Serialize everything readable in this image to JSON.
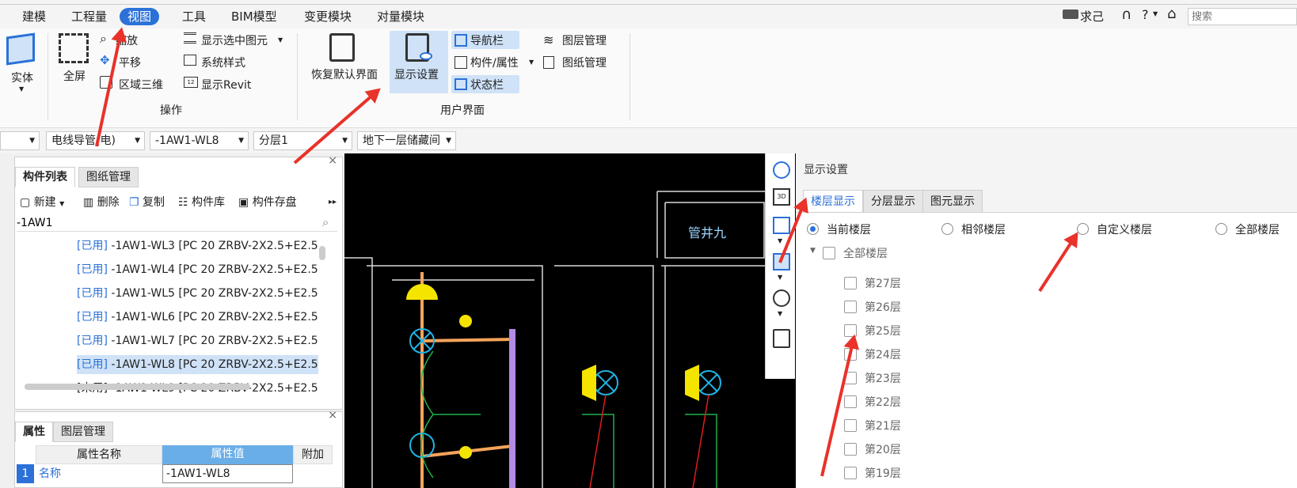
{
  "menu": {
    "items": [
      "建模",
      "工程量",
      "视图",
      "工具",
      "BIM模型",
      "变更模块",
      "对量模块"
    ],
    "active_index": 2,
    "right": {
      "user_label": "求己",
      "question_label": "?",
      "search_placeholder": "搜索"
    }
  },
  "ribbon": {
    "solid_label": "实体",
    "fullscreen_label": "全屏",
    "zoom_label": "缩放",
    "pan_label": "平移",
    "region3d_label": "区域三维",
    "show_selected_label": "显示选中图元",
    "system_style_label": "系统样式",
    "show_revit_label": "显示Revit",
    "operation_group": "操作",
    "restore_default_label": "恢复默认界面",
    "display_settings_label": "显示设置",
    "navbar_label": "导航栏",
    "component_props_label": "构件/属性",
    "statusbar_label": "状态栏",
    "layer_mgmt_label": "图层管理",
    "drawing_mgmt_label": "图纸管理",
    "ui_group": "用户界面"
  },
  "toolbar": {
    "combo1": "",
    "combo2": "电线导管(电)",
    "combo3": "-1AW1-WL8",
    "combo4": "分层1",
    "combo5": "地下一层储藏间"
  },
  "component_panel": {
    "tabs": [
      "构件列表",
      "图纸管理"
    ],
    "new_label": "新建",
    "delete_label": "删除",
    "copy_label": "复制",
    "library_label": "构件库",
    "save_label": "构件存盘",
    "search_value": "-1AW1",
    "rows": [
      {
        "status": "[已用]",
        "text": "-1AW1-WL3 [PC 20 ZRBV-2X2.5+E2.5"
      },
      {
        "status": "[已用]",
        "text": "-1AW1-WL4 [PC 20 ZRBV-2X2.5+E2.5"
      },
      {
        "status": "[已用]",
        "text": "-1AW1-WL5 [PC 20 ZRBV-2X2.5+E2.5"
      },
      {
        "status": "[已用]",
        "text": "-1AW1-WL6 [PC 20 ZRBV-2X2.5+E2.5"
      },
      {
        "status": "[已用]",
        "text": "-1AW1-WL7 [PC 20 ZRBV-2X2.5+E2.5"
      },
      {
        "status": "[已用]",
        "text": "-1AW1-WL8 [PC 20 ZRBV-2X2.5+E2.5"
      },
      {
        "status": "[未用]",
        "text": "-1AW1-WL9 [PC 20 ZRBV-2X2.5+E2.5"
      }
    ],
    "selected_index": 5
  },
  "property_panel": {
    "tabs": [
      "属性",
      "图层管理"
    ],
    "headers": [
      "属性名称",
      "属性值",
      "附加"
    ],
    "rows": [
      {
        "no": "1",
        "name": "名称",
        "value": "-1AW1-WL8"
      }
    ]
  },
  "canvas": {
    "label": "管井九"
  },
  "settings": {
    "title": "显示设置",
    "tabs": [
      "楼层显示",
      "分层显示",
      "图元显示"
    ],
    "radios": [
      "当前楼层",
      "相邻楼层",
      "自定义楼层",
      "全部楼层"
    ],
    "radio_selected": 0,
    "all_floors_label": "全部楼层",
    "floors": [
      "第27层",
      "第26层",
      "第25层",
      "第24层",
      "第23层",
      "第22层",
      "第21层",
      "第20层",
      "第19层"
    ]
  },
  "colors": {
    "accent": "#2b71d8",
    "annotation_arrow": "#e8322a",
    "selected_bg": "#cfe2f7"
  }
}
